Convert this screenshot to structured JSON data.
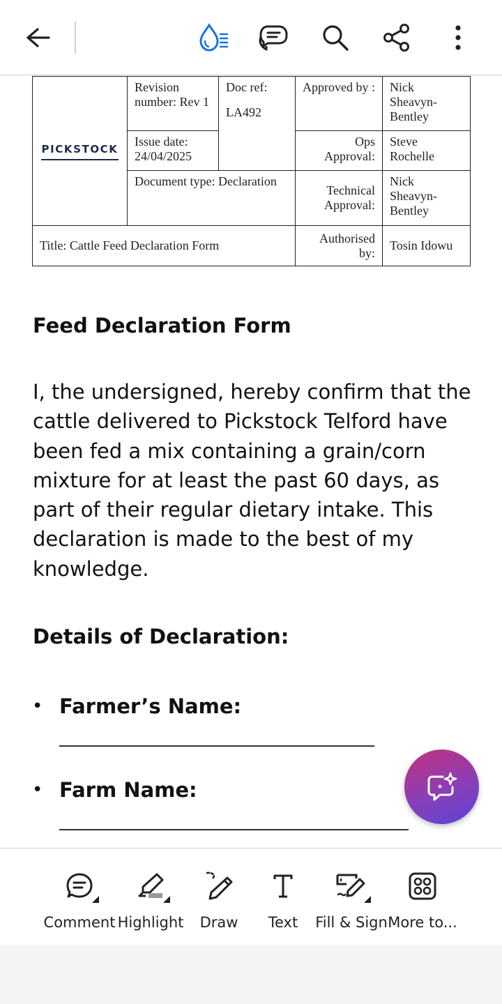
{
  "topbar": {
    "icons": [
      "back-arrow-icon",
      "liquid-mode-icon",
      "comments-icon",
      "search-icon",
      "share-icon",
      "more-vertical-icon"
    ]
  },
  "doc_header": {
    "logo_text": "PICKSTOCK",
    "revision": "Revision number: Rev 1",
    "doc_ref_label": "Doc ref:",
    "doc_ref_value": "LA492",
    "approved_by_label": "Approved by :",
    "approved_by_value": "Nick Sheavyn-Bentley",
    "issue_date": "Issue date: 24/04/2025",
    "ops_approval_label": "Ops Approval:",
    "ops_approval_value": "Steve Rochelle",
    "doc_type": "Document type: Declaration",
    "technical_approval_label": "Technical Approval:",
    "technical_approval_value": "Nick Sheavyn-Bentley",
    "title": "Title: Cattle Feed Declaration Form",
    "authorised_by_label": "Authorised by:",
    "authorised_by_value": "Tosin Idowu"
  },
  "content": {
    "heading": "Feed Declaration Form",
    "paragraph": "I, the undersigned, hereby confirm that the cattle delivered to Pickstock Telford have been fed a mix containing a grain/corn mixture for at least the past 60 days, as part of their regular dietary intake. This declaration is made to the best of my knowledge.",
    "details_heading": "Details of Declaration:",
    "bullet_char": "•",
    "fields": [
      {
        "label": "Farmer’s Name:"
      },
      {
        "label": "Farm Name:"
      }
    ]
  },
  "fab": {
    "icon": "ai-assistant-icon"
  },
  "toolbar": {
    "items": [
      {
        "label": "Comment",
        "icon": "comment-icon"
      },
      {
        "label": "Highlight",
        "icon": "highlight-icon"
      },
      {
        "label": "Draw",
        "icon": "draw-icon"
      },
      {
        "label": "Text",
        "icon": "text-icon"
      },
      {
        "label": "Fill & Sign",
        "icon": "fill-sign-icon"
      },
      {
        "label": "More to...",
        "icon": "more-tools-icon"
      }
    ]
  },
  "colors": {
    "accent_blue": "#1473e6",
    "fab_gradient_start": "#c2307a",
    "fab_gradient_end": "#5b44d8",
    "logo_navy": "#1c2a4a"
  }
}
